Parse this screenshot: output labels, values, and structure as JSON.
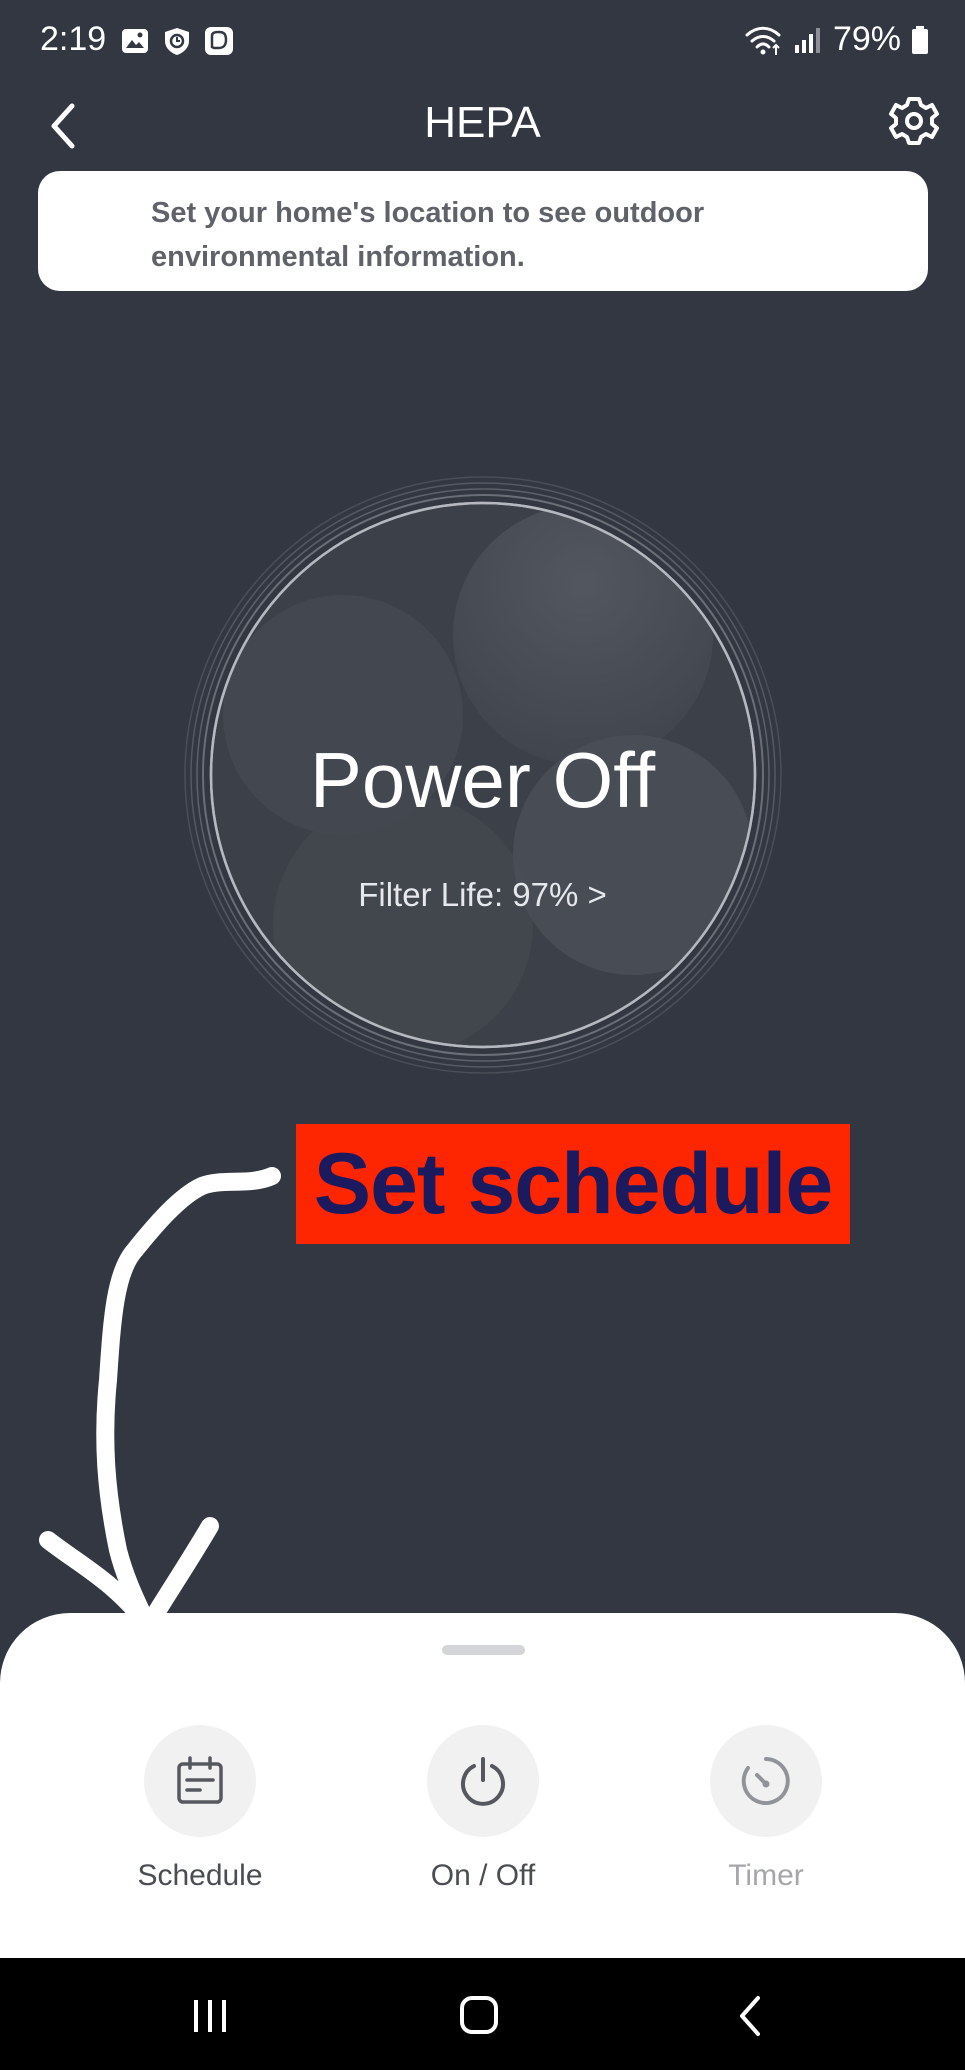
{
  "status_bar": {
    "time": "2:19",
    "battery": "79%",
    "left_icons": [
      "gallery-icon",
      "shield-icon",
      "messenger-icon"
    ],
    "right_icons": [
      "wifi-icon",
      "signal-icon",
      "battery-icon"
    ]
  },
  "header": {
    "title": "HEPA",
    "back_icon": "back-arrow-icon",
    "settings_icon": "gear-icon"
  },
  "banner": {
    "text": "Set your home's location to see outdoor environmental information."
  },
  "device": {
    "power_state": "Power Off",
    "filter_life": "Filter Life: 97% >"
  },
  "annotation": {
    "label": "Set schedule",
    "label_bg": "#fe2600",
    "label_color": "#1b1a5e"
  },
  "actions": [
    {
      "label": "Schedule",
      "icon": "calendar-icon",
      "enabled": true
    },
    {
      "label": "On / Off",
      "icon": "power-icon",
      "enabled": true
    },
    {
      "label": "Timer",
      "icon": "timer-icon",
      "enabled": false
    }
  ],
  "nav_bar": {
    "buttons": [
      "recent-apps-icon",
      "home-icon",
      "back-icon"
    ]
  },
  "colors": {
    "background": "#323741",
    "sheet": "#ffffff"
  }
}
